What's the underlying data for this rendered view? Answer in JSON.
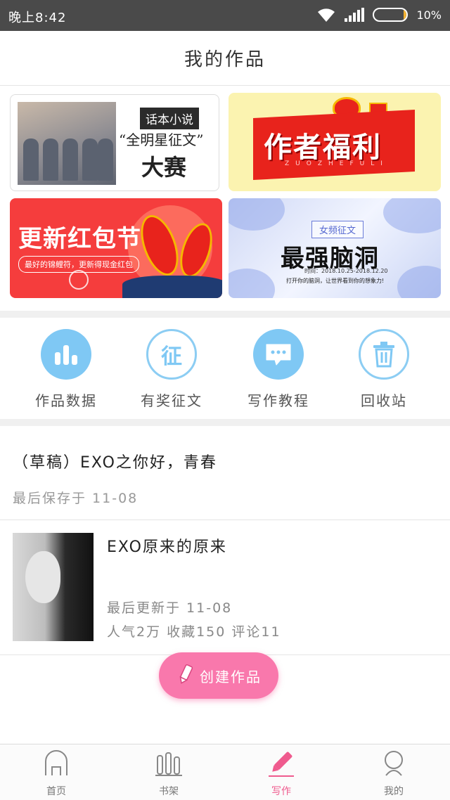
{
  "status_bar": {
    "time": "晚上8:42",
    "battery_percent": "10%",
    "battery_level": 0.1
  },
  "header": {
    "title": "我的作品"
  },
  "banners": [
    {
      "tag": "话本小说",
      "subtitle": "“全明星征文”",
      "title": "大赛"
    },
    {
      "title": "作者福利",
      "subtitle": "ZUOZHEFULI"
    },
    {
      "title": "更新红包节",
      "caption": "最好的锦鲤符，更新得现金红包"
    },
    {
      "tag": "女频征文",
      "title": "最强脑洞",
      "date": "时间：2018.10.25-2018.12.20",
      "slogan": "打开你的脑洞，让世界看到你的想象力!"
    }
  ],
  "actions": [
    {
      "label": "作品数据",
      "icon": "bar-chart-icon"
    },
    {
      "label": "有奖征文",
      "icon": "contest-icon",
      "glyph": "征"
    },
    {
      "label": "写作教程",
      "icon": "chat-bubble-icon"
    },
    {
      "label": "回收站",
      "icon": "trash-icon"
    }
  ],
  "draft": {
    "title": "（草稿）EXO之你好，青春",
    "saved": "最后保存于 11-08"
  },
  "work": {
    "title": "EXO原来的原来",
    "updated": "最后更新于 11-08",
    "popularity": "人气2万",
    "favorites": "收藏150",
    "comments": "评论11"
  },
  "create_button": {
    "label": "创建作品"
  },
  "tabs": [
    {
      "label": "首页",
      "icon": "home-icon",
      "active": false
    },
    {
      "label": "书架",
      "icon": "bookshelf-icon",
      "active": false
    },
    {
      "label": "写作",
      "icon": "pencil-icon",
      "active": true
    },
    {
      "label": "我的",
      "icon": "profile-icon",
      "active": false
    }
  ],
  "colors": {
    "accent_pink": "#f978ac",
    "action_blue": "#7fc8f4",
    "status_bar": "#4a4a4a"
  }
}
